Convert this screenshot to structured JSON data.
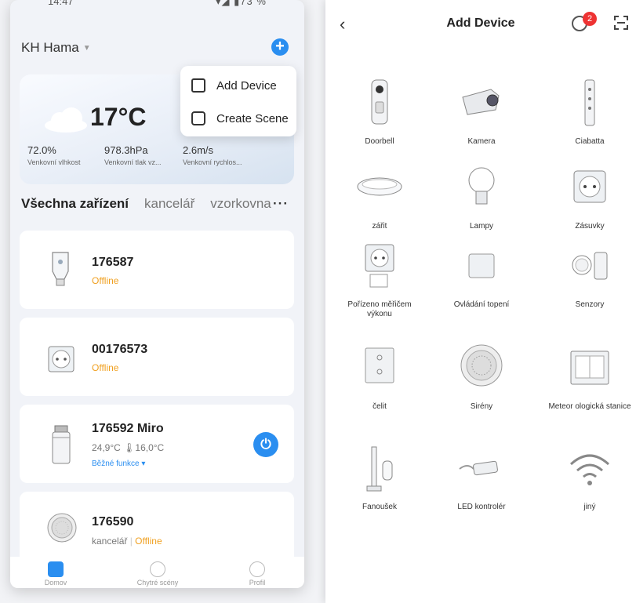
{
  "status_bar": {
    "time": "14:47",
    "right": "▾◢ ▮73 %"
  },
  "home": {
    "name": "KH Hama"
  },
  "weather": {
    "temperature": "17°C",
    "humidity_value": "72.0%",
    "humidity_label": "Venkovní vlhkost",
    "pressure_value": "978.3hPa",
    "pressure_label": "Venkovní tlak vz...",
    "wind_value": "2.6m/s",
    "wind_label": "Venkovní rychlos..."
  },
  "popup": {
    "add_device": "Add Device",
    "create_scene": "Create Scene"
  },
  "tabs": {
    "all": "Všechna zařízení",
    "office": "kancelář",
    "showroom": "vzorkovna",
    "more": "···"
  },
  "devices": [
    {
      "name": "176587",
      "status": "Offline"
    },
    {
      "name": "00176573",
      "status": "Offline"
    },
    {
      "name": "176592 Miro",
      "temps": "24,9°C  🌡16,0°C",
      "functions": "Běžné funkce ▾"
    },
    {
      "name": "176590",
      "room": "kancelář",
      "status": "Offline"
    }
  ],
  "bottom_nav": [
    "Domov",
    "Chytré scény",
    "Profil"
  ],
  "add_device": {
    "title": "Add Device",
    "badge": "2",
    "items": [
      {
        "label": "Doorbell"
      },
      {
        "label": "Kamera"
      },
      {
        "label": "Ciabatta"
      },
      {
        "label": "zářit"
      },
      {
        "label": "Lampy"
      },
      {
        "label": "Zásuvky"
      },
      {
        "label": "Pořízeno měřičem výkonu"
      },
      {
        "label": "Ovládání topení"
      },
      {
        "label": "Senzory"
      },
      {
        "label": "čelit"
      },
      {
        "label": "Sirény"
      },
      {
        "label": "Meteor ologická stanice"
      },
      {
        "label": "Fanoušek"
      },
      {
        "label": "LED kontrolér"
      },
      {
        "label": "jiný"
      }
    ]
  },
  "colors": {
    "accent": "#2a8ef0",
    "offline": "#f0a020",
    "badge": "#ee3333"
  }
}
